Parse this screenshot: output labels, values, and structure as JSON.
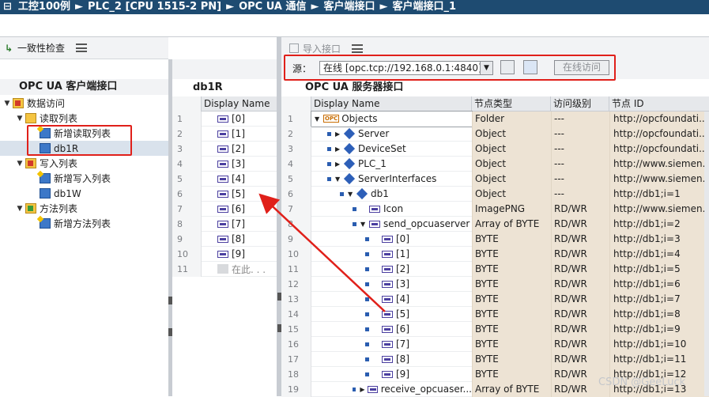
{
  "breadcrumb": {
    "items": [
      "工控100例",
      "PLC_2 [CPU 1515-2 PN]",
      "OPC UA 通信",
      "客户端接口",
      "客户端接口_1"
    ],
    "separator": "►"
  },
  "left_panel": {
    "toolbar_check_label": "一致性检查",
    "header": "OPC UA 客户端接口",
    "tree": [
      {
        "label": "数据访问",
        "expanded": true
      },
      {
        "label": "读取列表",
        "expanded": true
      },
      {
        "label": "新增读取列表"
      },
      {
        "label": "db1R"
      },
      {
        "label": "写入列表",
        "expanded": true
      },
      {
        "label": "新增写入列表"
      },
      {
        "label": "db1W"
      },
      {
        "label": "方法列表",
        "expanded": true
      },
      {
        "label": "新增方法列表"
      }
    ]
  },
  "middle_panel": {
    "header": "db1R",
    "column_header": "Display Name",
    "rows": [
      {
        "num": "1",
        "name": "[0]"
      },
      {
        "num": "2",
        "name": "[1]"
      },
      {
        "num": "3",
        "name": "[2]"
      },
      {
        "num": "4",
        "name": "[3]"
      },
      {
        "num": "5",
        "name": "[4]"
      },
      {
        "num": "6",
        "name": "[5]"
      },
      {
        "num": "7",
        "name": "[6]"
      },
      {
        "num": "8",
        "name": "[7]"
      },
      {
        "num": "9",
        "name": "[8]"
      },
      {
        "num": "10",
        "name": "[9]"
      },
      {
        "num": "11",
        "name": "在此. . ."
      }
    ]
  },
  "right_panel": {
    "toolbar_import_label": "导入接口",
    "source_label": "源：",
    "source_value": "在线 [opc.tcp://192.168.0.1:4840]",
    "online_access_label": "在线访问",
    "header": "OPC UA 服务器接口",
    "columns": [
      "Display Name",
      "节点类型",
      "访问级别",
      "节点 ID"
    ],
    "rows": [
      {
        "num": "1",
        "name": "Objects",
        "type": "Folder",
        "access": "---",
        "id": "http://opcfoundati..."
      },
      {
        "num": "2",
        "name": "Server",
        "type": "Object",
        "access": "---",
        "id": "http://opcfoundati..."
      },
      {
        "num": "3",
        "name": "DeviceSet",
        "type": "Object",
        "access": "---",
        "id": "http://opcfoundati..."
      },
      {
        "num": "4",
        "name": "PLC_1",
        "type": "Object",
        "access": "---",
        "id": "http://www.siemen..."
      },
      {
        "num": "5",
        "name": "ServerInterfaces",
        "type": "Object",
        "access": "---",
        "id": "http://www.siemen..."
      },
      {
        "num": "6",
        "name": "db1",
        "type": "Object",
        "access": "---",
        "id": "http://db1;i=1"
      },
      {
        "num": "7",
        "name": "Icon",
        "type": "ImagePNG",
        "access": "RD/WR",
        "id": "http://www.siemen..."
      },
      {
        "num": "8",
        "name": "send_opcuaserver",
        "type": "Array of BYTE",
        "access": "RD/WR",
        "id": "http://db1;i=2"
      },
      {
        "num": "9",
        "name": "[0]",
        "type": "BYTE",
        "access": "RD/WR",
        "id": "http://db1;i=3"
      },
      {
        "num": "10",
        "name": "[1]",
        "type": "BYTE",
        "access": "RD/WR",
        "id": "http://db1;i=4"
      },
      {
        "num": "11",
        "name": "[2]",
        "type": "BYTE",
        "access": "RD/WR",
        "id": "http://db1;i=5"
      },
      {
        "num": "12",
        "name": "[3]",
        "type": "BYTE",
        "access": "RD/WR",
        "id": "http://db1;i=6"
      },
      {
        "num": "13",
        "name": "[4]",
        "type": "BYTE",
        "access": "RD/WR",
        "id": "http://db1;i=7"
      },
      {
        "num": "14",
        "name": "[5]",
        "type": "BYTE",
        "access": "RD/WR",
        "id": "http://db1;i=8"
      },
      {
        "num": "15",
        "name": "[6]",
        "type": "BYTE",
        "access": "RD/WR",
        "id": "http://db1;i=9"
      },
      {
        "num": "16",
        "name": "[7]",
        "type": "BYTE",
        "access": "RD/WR",
        "id": "http://db1;i=10"
      },
      {
        "num": "17",
        "name": "[8]",
        "type": "BYTE",
        "access": "RD/WR",
        "id": "http://db1;i=11"
      },
      {
        "num": "18",
        "name": "[9]",
        "type": "BYTE",
        "access": "RD/WR",
        "id": "http://db1;i=12"
      },
      {
        "num": "19",
        "name": "receive_opcuaser...",
        "type": "Array of BYTE",
        "access": "RD/WR",
        "id": "http://db1;i=13"
      }
    ]
  },
  "watermark": "CSDN @GeeLuck",
  "colors": {
    "titlebar": "#1e4b71",
    "highlight": "#e0201a",
    "property_cell": "#ede3d4",
    "node_icon": "#2d5fb8"
  }
}
